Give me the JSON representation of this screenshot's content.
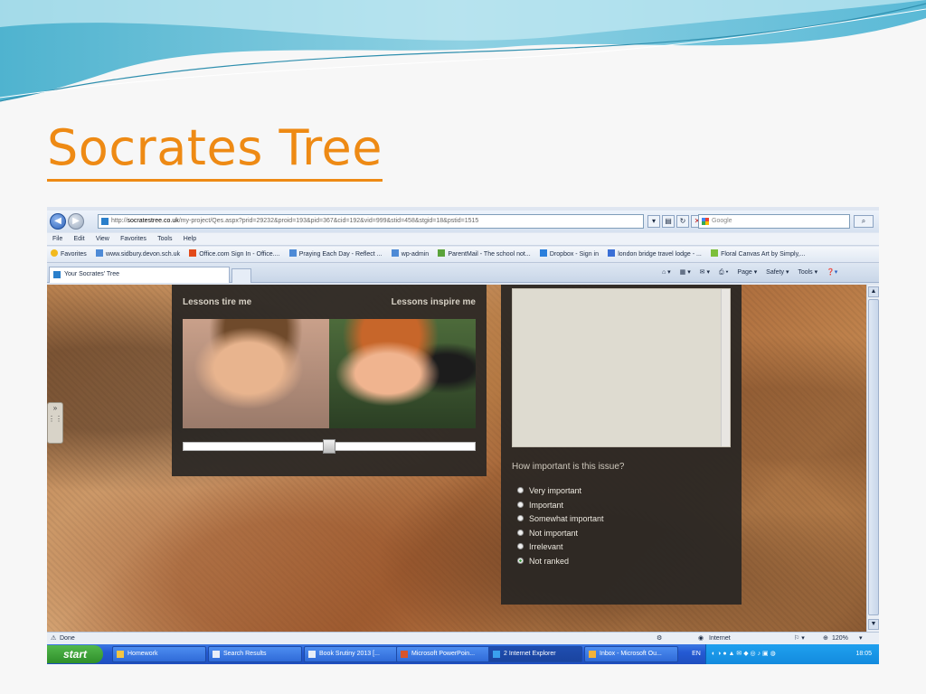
{
  "slide": {
    "title": "Socrates Tree",
    "accent_color": "#ee8a14"
  },
  "browser": {
    "url_prefix": "http://",
    "url_host": "socratestree.co.uk",
    "url_path": "/my-project/Qes.aspx?prid=29232&proid=193&pid=367&cid=192&vid=999&stid=458&stgid=18&pstid=1515",
    "search_placeholder": "Google",
    "menu": [
      "File",
      "Edit",
      "View",
      "Favorites",
      "Tools",
      "Help"
    ],
    "favorites_label": "Favorites",
    "favorites": [
      "www.sidbury.devon.sch.uk",
      "Office.com Sign In - Office....",
      "Praying Each Day - Reflect ...",
      "wp-admin",
      "ParentMail - The school not...",
      "Dropbox - Sign in",
      "london bridge travel lodge - ...",
      "Floral Canvas Art by Simply,..."
    ],
    "tab_title": "Your Socrates' Tree",
    "command_bar": [
      "Page ▾",
      "Safety ▾",
      "Tools ▾"
    ],
    "status_left": "Done",
    "status_zone": "Internet",
    "zoom": "120%"
  },
  "app": {
    "left_label": "Lessons tire me",
    "right_label": "Lessons inspire me",
    "slider_value": 0.5,
    "question": "How important is this issue?",
    "options": [
      "Very important",
      "Important",
      "Somewhat important",
      "Not important",
      "Irrelevant",
      "Not ranked"
    ],
    "selected_option": "Not ranked"
  },
  "taskbar": {
    "start_label": "start",
    "tasks": [
      "Homework",
      "Search Results",
      "Book Srutiny 2013 [...",
      "Microsoft PowerPoin...",
      "2 Internet Explorer",
      "Inbox - Microsoft Ou..."
    ],
    "language": "EN",
    "clock": "18:05"
  }
}
